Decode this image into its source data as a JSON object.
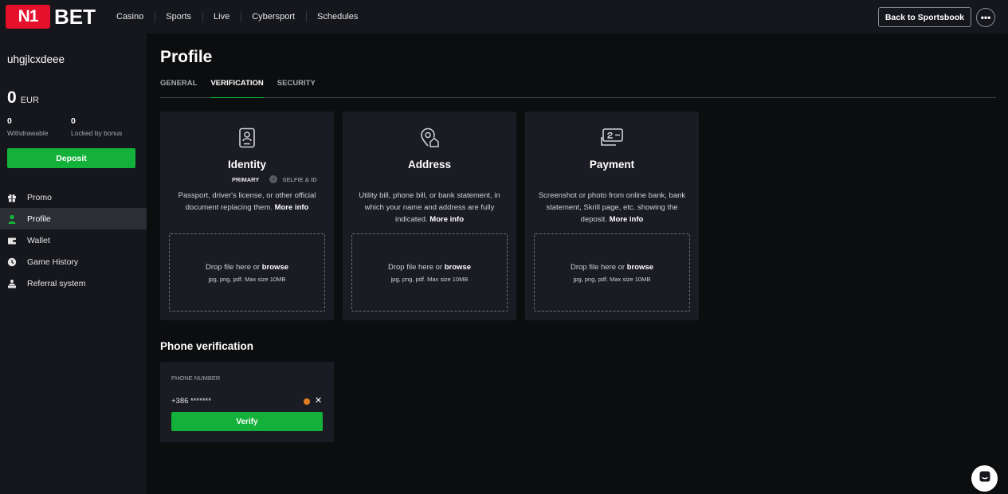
{
  "header": {
    "logo_mark": "N1",
    "logo_text": "BET",
    "nav": [
      "Casino",
      "Sports",
      "Live",
      "Cybersport",
      "Schedules"
    ],
    "back_label": "Back to Sportsbook",
    "more_label": "•••"
  },
  "sidebar": {
    "username": "uhgjlcxdeee",
    "balance": {
      "amount": "0",
      "currency": "EUR"
    },
    "withdrawable": {
      "value": "0",
      "label": "Withdrawable"
    },
    "locked": {
      "value": "0",
      "label": "Locked by bonus"
    },
    "deposit_label": "Deposit",
    "menu": [
      {
        "label": "Promo",
        "icon": "gift-icon"
      },
      {
        "label": "Profile",
        "icon": "user-icon",
        "active": true
      },
      {
        "label": "Wallet",
        "icon": "wallet-icon"
      },
      {
        "label": "Game History",
        "icon": "history-icon"
      },
      {
        "label": "Referral system",
        "icon": "referral-icon"
      }
    ]
  },
  "main": {
    "title": "Profile",
    "tabs": [
      {
        "label": "GENERAL"
      },
      {
        "label": "VERIFICATION",
        "active": true
      },
      {
        "label": "SECURITY"
      }
    ],
    "cards": [
      {
        "title": "Identity",
        "icon": "id-card-icon",
        "primary_label": "PRIMARY",
        "secondary_label": "SELFIE & ID",
        "desc": "Passport, driver's license, or other official document replacing them.",
        "more": "More info",
        "drop_text": "Drop file here or",
        "drop_link": "browse",
        "drop_hint": "jpg, png, pdf. Max size 10MB"
      },
      {
        "title": "Address",
        "icon": "location-home-icon",
        "desc": "Utility bill, phone bill, or bank statement, in which your name and address are fully indicated.",
        "more": "More info",
        "drop_text": "Drop file here or",
        "drop_link": "browse",
        "drop_hint": "jpg, png, pdf. Max size 10MB"
      },
      {
        "title": "Payment",
        "icon": "payment-card-icon",
        "desc": "Screenshot or photo from online bank, bank statement, Skrill page, etc. showing the deposit.",
        "more": "More info",
        "drop_text": "Drop file here or",
        "drop_link": "browse",
        "drop_hint": "jpg, png, pdf. Max size 10MB"
      }
    ],
    "phone": {
      "title": "Phone verification",
      "label": "PHONE NUMBER",
      "value": "+386 *******",
      "clear": "✕",
      "verify_label": "Verify"
    }
  },
  "colors": {
    "accent": "#14b13a",
    "brand": "#e5102b",
    "warning": "#e27d24",
    "panel": "#1b1c23"
  }
}
